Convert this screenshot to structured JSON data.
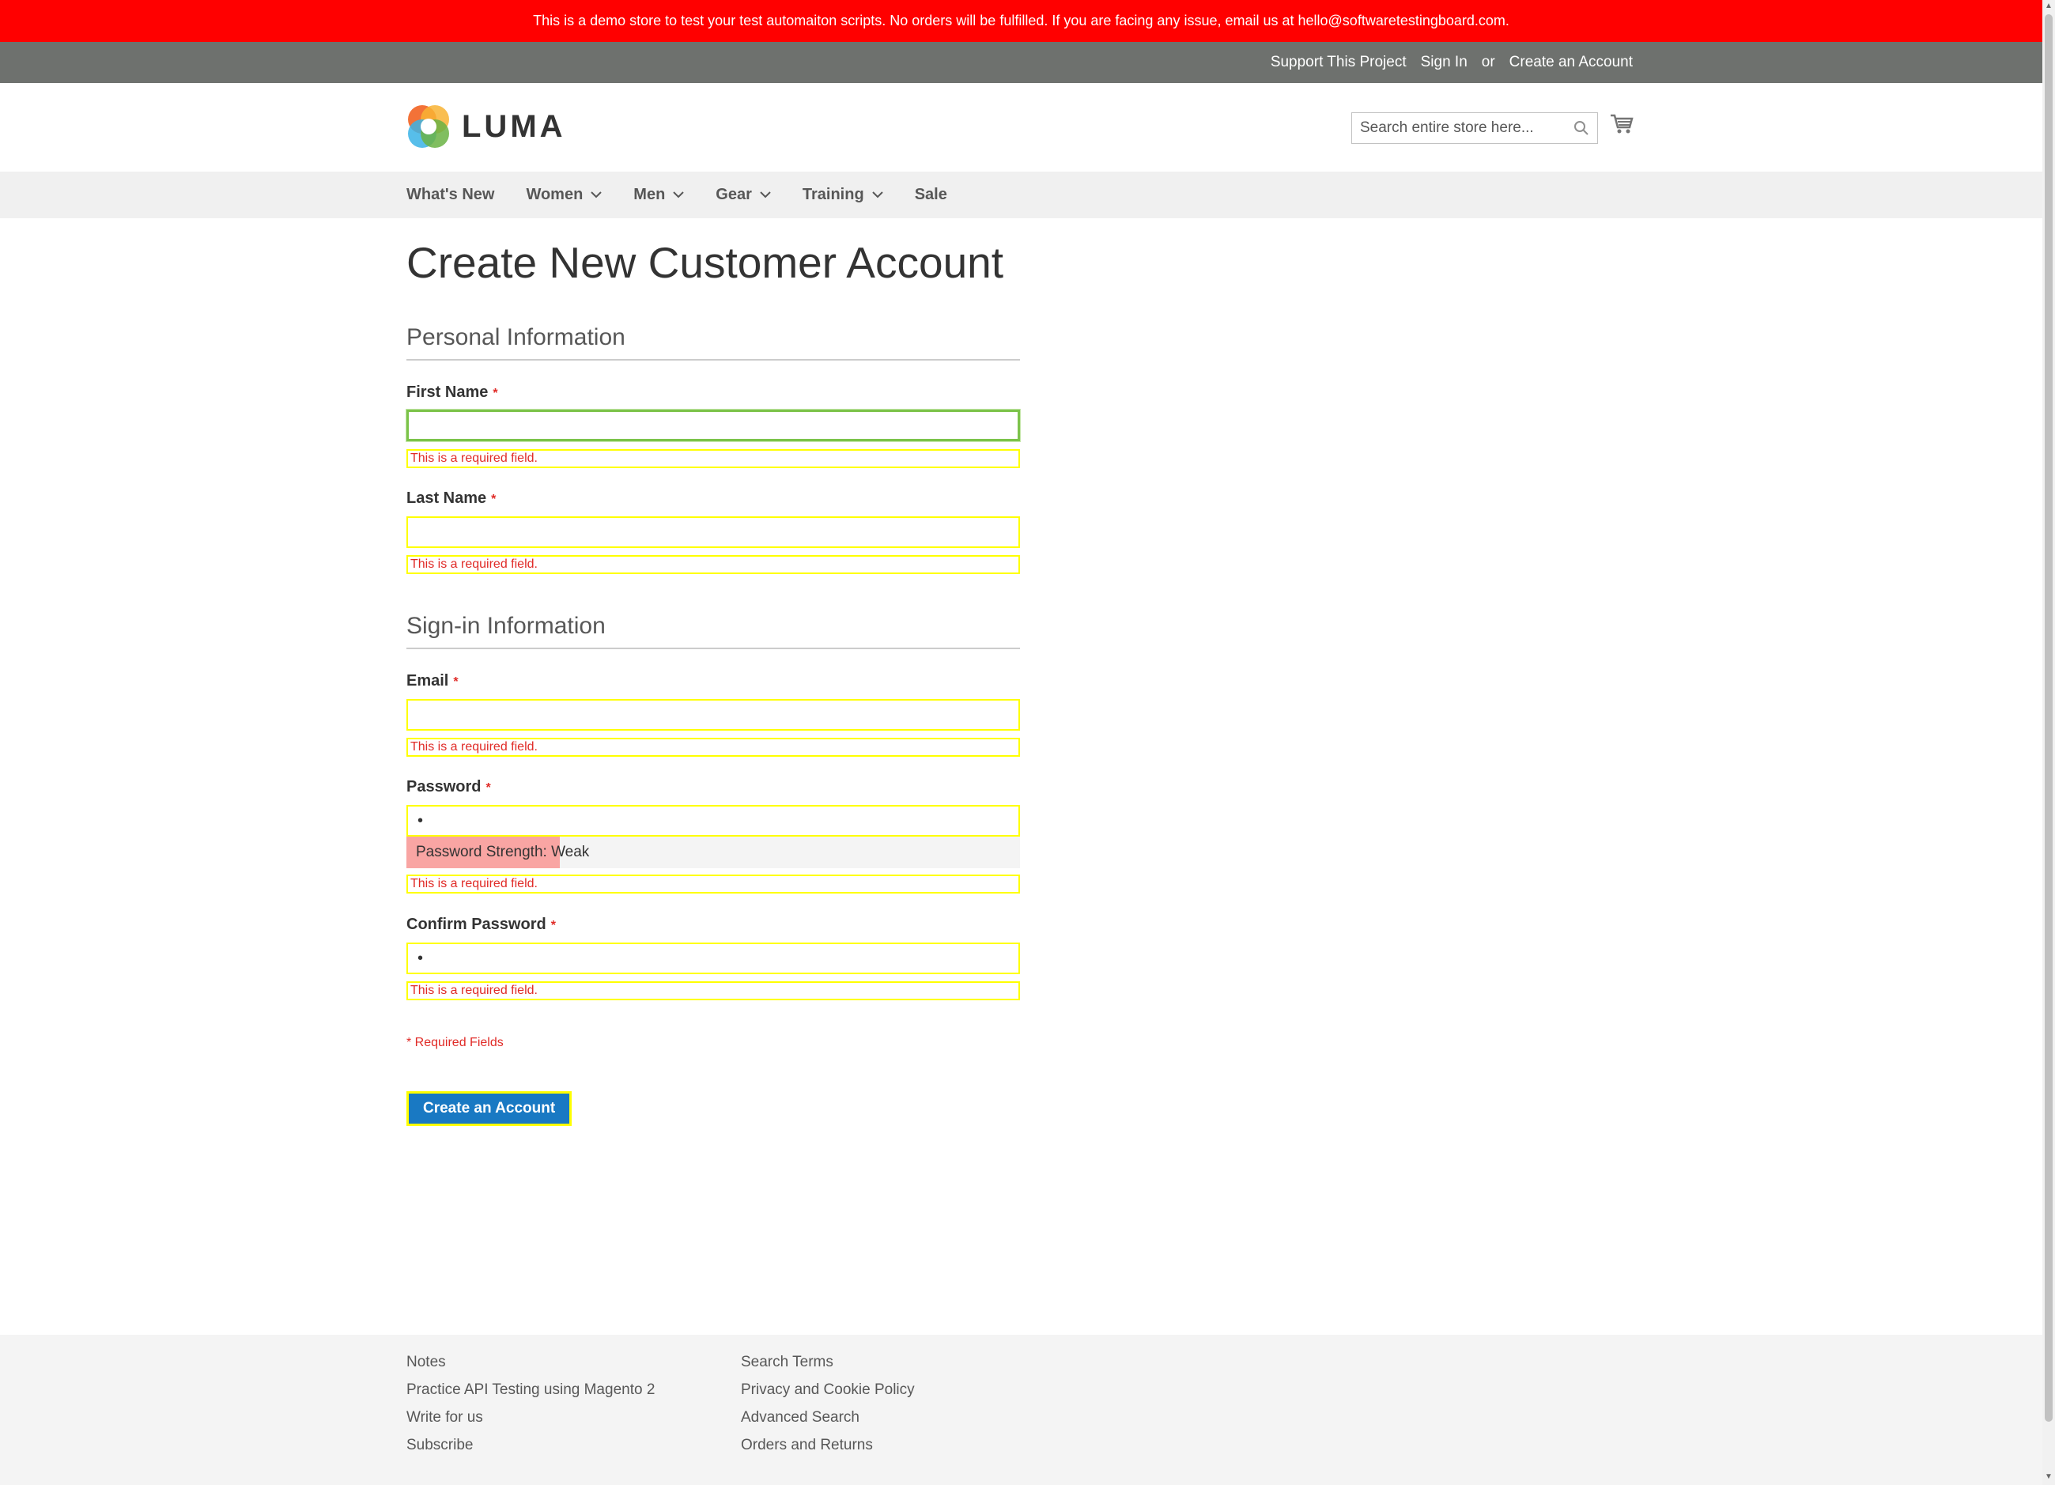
{
  "banner": {
    "text": "This is a demo store to test your test automaiton scripts. No orders will be fulfilled. If you are facing any issue, email us at hello@softwaretestingboard.com."
  },
  "topbar": {
    "support": "Support This Project",
    "sign_in": "Sign In",
    "or": "or",
    "create_account": "Create an Account"
  },
  "header": {
    "logo_text": "LUMA",
    "search_placeholder": "Search entire store here..."
  },
  "nav": {
    "items": [
      {
        "label": "What's New"
      },
      {
        "label": "Women"
      },
      {
        "label": "Men"
      },
      {
        "label": "Gear"
      },
      {
        "label": "Training"
      },
      {
        "label": "Sale"
      }
    ]
  },
  "page": {
    "title": "Create New Customer Account"
  },
  "sections": {
    "personal": "Personal Information",
    "signin": "Sign-in Information"
  },
  "fields": {
    "first_name": {
      "label": "First Name",
      "value": "",
      "error": "This is a required field."
    },
    "last_name": {
      "label": "Last Name",
      "value": "",
      "error": "This is a required field."
    },
    "email": {
      "label": "Email",
      "value": "",
      "error": "This is a required field."
    },
    "password": {
      "label": "Password",
      "value": "•",
      "error": "This is a required field."
    },
    "confirm_password": {
      "label": "Confirm Password",
      "value": "•",
      "error": "This is a required field."
    }
  },
  "required_marker": "*",
  "password_strength": {
    "text": "Password Strength: Weak",
    "level": 0.25
  },
  "required_note": "* Required Fields",
  "submit_button": "Create an Account",
  "footer": {
    "col1": [
      "Notes",
      "Practice API Testing using Magento 2",
      "Write for us",
      "Subscribe"
    ],
    "col2": [
      "Search Terms",
      "Privacy and Cookie Policy",
      "Advanced Search",
      "Orders and Returns"
    ]
  },
  "colors": {
    "banner": "#ff0000",
    "topbar": "#6e716e",
    "primary": "#1979c3",
    "error": "#e02b27",
    "highlight": "#ffff00"
  }
}
